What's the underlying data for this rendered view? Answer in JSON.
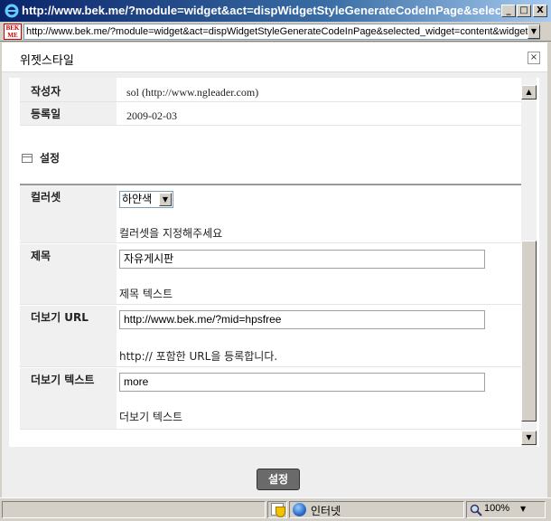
{
  "window": {
    "title": "http://www.bek.me/?module=widget&act=dispWidgetStyleGenerateCodeInPage&selected...",
    "min_glyph": "_",
    "max_glyph": "□",
    "close_glyph": "X"
  },
  "address": {
    "favicon_text": "BEK ME",
    "url": "http://www.bek.me/?module=widget&act=dispWidgetStyleGenerateCodeInPage&selected_widget=content&widget",
    "dropdown_glyph": "▼"
  },
  "popup": {
    "title": "위젯스타일",
    "close_glyph": "×"
  },
  "info_rows": [
    {
      "label": "작성자",
      "value": "sol (http://www.ngleader.com)"
    },
    {
      "label": "등록일",
      "value": "2009-02-03"
    }
  ],
  "section_title": "설정",
  "fields": {
    "colorset": {
      "label": "컬러셋",
      "selected": "하얀색",
      "description": "컬러셋을 지정해주세요"
    },
    "title": {
      "label": "제목",
      "value": "자유게시판",
      "description": "제목 텍스트"
    },
    "more_url": {
      "label": "더보기 URL",
      "value": "http://www.bek.me/?mid=hpsfree",
      "description": "http:// 포함한 URL을 등록합니다."
    },
    "more_text": {
      "label": "더보기 텍스트",
      "value": "more",
      "description": "더보기 텍스트"
    }
  },
  "scrollbar": {
    "up_glyph": "▲",
    "down_glyph": "▼"
  },
  "submit_label": "설정",
  "status": {
    "zone": "인터넷",
    "zoom": "100%",
    "zoom_glyph": "▼"
  },
  "colors": {
    "title_bar": "#0a246a",
    "submit_button": "#6a6a6a",
    "page_bg": "#eeeeee"
  }
}
